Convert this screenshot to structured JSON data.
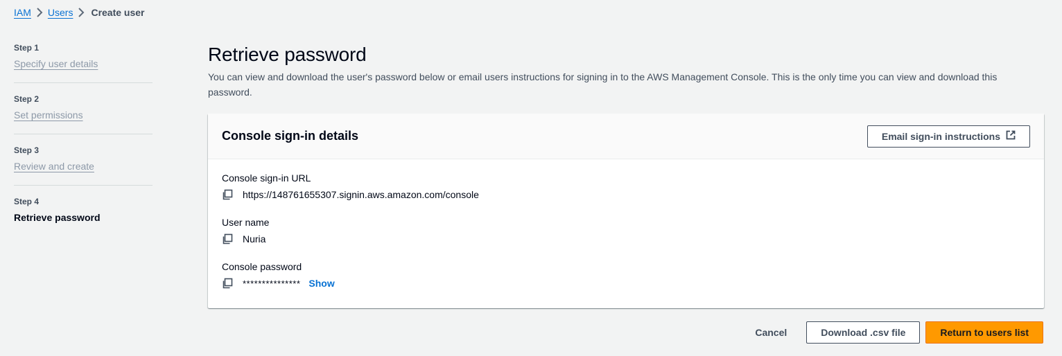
{
  "breadcrumb": {
    "items": [
      {
        "label": "IAM"
      },
      {
        "label": "Users"
      }
    ],
    "current": "Create user"
  },
  "steps": [
    {
      "num": "Step 1",
      "label": "Specify user details"
    },
    {
      "num": "Step 2",
      "label": "Set permissions"
    },
    {
      "num": "Step 3",
      "label": "Review and create"
    },
    {
      "num": "Step 4",
      "label": "Retrieve password"
    }
  ],
  "main": {
    "title": "Retrieve password",
    "description": "You can view and download the user's password below or email users instructions for signing in to the AWS Management Console. This is the only time you can view and download this password."
  },
  "card": {
    "title": "Console sign-in details",
    "email_button": "Email sign-in instructions",
    "fields": {
      "url_label": "Console sign-in URL",
      "url_value": "https://148761655307.signin.aws.amazon.com/console",
      "username_label": "User name",
      "username_value": "Nuria",
      "password_label": "Console password",
      "password_mask": "***************",
      "show_label": "Show"
    }
  },
  "actions": {
    "cancel": "Cancel",
    "download": "Download .csv file",
    "return": "Return to users list"
  },
  "colors": {
    "link": "#0972d3",
    "primary": "#ff9900",
    "background": "#f2f3f3"
  }
}
